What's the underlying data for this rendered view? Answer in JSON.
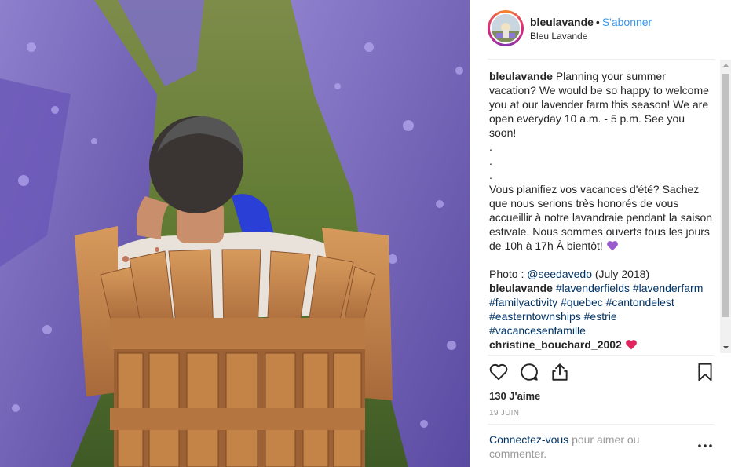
{
  "photo": {
    "alt_subject": "person-in-adirondack-chair-lavender-field"
  },
  "header": {
    "username": "bleulavande",
    "separator": "•",
    "follow_label": "S'abonner",
    "location": "Bleu Lavande"
  },
  "caption": {
    "username": "bleulavande",
    "text_en": "Planning your summer vacation? We would be so happy to welcome you at our lavender farm this season! We are open everyday 10 a.m. - 5 p.m. See you soon!",
    "dot1": ".",
    "dot2": ".",
    "dot3": ".",
    "text_fr": "Vous planifiez vos vacances d'été? Sachez que nous serions très honorés de vous accueillir à notre lavandraie pendant la saison estivale. Nous sommes ouverts tous les jours de 10h à 17h À bientôt!",
    "photo_credit_prefix": "Photo :",
    "photo_credit_handle": "@seedavedo",
    "photo_credit_suffix": "(July 2018)"
  },
  "hashtag_comment": {
    "username": "bleulavande",
    "tags": [
      "#lavenderfields",
      "#lavenderfarm",
      "#familyactivity",
      "#quebec",
      "#cantondelest",
      "#easterntownships",
      "#estrie",
      "#vacancesenfamille"
    ]
  },
  "comment2": {
    "username": "christine_bouchard_2002"
  },
  "icons": {
    "like": "heart-outline-icon",
    "comment": "speech-bubble-icon",
    "share": "share-upload-icon",
    "save": "bookmark-icon",
    "more": "ellipsis-icon"
  },
  "stats": {
    "likes": "130 J'aime",
    "date": "19 juin"
  },
  "login": {
    "link": "Connectez-vous",
    "rest": "pour aimer ou commenter."
  },
  "colors": {
    "link_blue": "#3897f0",
    "hashtag_navy": "#003569",
    "muted_gray": "#999999",
    "heart_purple": "#9b59d0",
    "heart_red": "#e0245e"
  }
}
